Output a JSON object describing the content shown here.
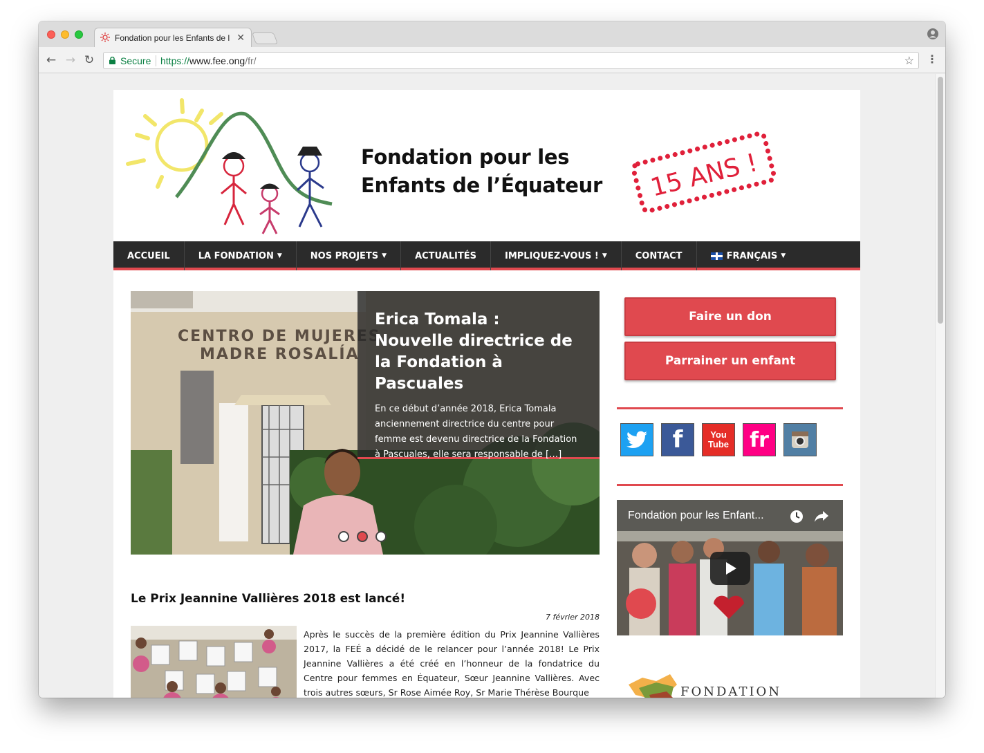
{
  "browser": {
    "tab_title": "Fondation pour les Enfants de l",
    "tab_close": "✕",
    "secure_label": "Secure",
    "url_scheme": "https://",
    "url_host": "www.fee.ong",
    "url_path": "/fr/"
  },
  "site": {
    "title_line1": "Fondation pour les",
    "title_line2": "Enfants de l’Équateur",
    "stamp": "15 ANS !"
  },
  "nav": {
    "items": [
      {
        "label": "ACCUEIL",
        "dropdown": false
      },
      {
        "label": "LA FONDATION",
        "dropdown": true
      },
      {
        "label": "NOS PROJETS",
        "dropdown": true
      },
      {
        "label": "ACTUALITÉS",
        "dropdown": false
      },
      {
        "label": "IMPLIQUEZ-VOUS !",
        "dropdown": true
      },
      {
        "label": "CONTACT",
        "dropdown": false
      },
      {
        "label": "FRANÇAIS",
        "dropdown": true,
        "flag": true
      }
    ]
  },
  "slider": {
    "sign_line1": "CENTRO DE MUJERES",
    "sign_line2": "MADRE ROSALÍA",
    "title": "Erica Tomala : Nouvelle directrice de la Fondation à Pascuales",
    "text": "En ce début d’année 2018, Erica Tomala anciennement directrice du centre pour femme est devenu directrice de la Fondation à Pascuales, elle sera responsable de […]",
    "slides_count": 3,
    "active_slide": 2
  },
  "article": {
    "title": "Le Prix Jeannine Vallières 2018 est lancé!",
    "date": "7 février 2018",
    "text": "Après le succès de la première édition du Prix Jeannine Vallières 2017, la FEÉ a décidé de le relancer pour l’année 2018! Le Prix Jeannine Vallières a été créé en l’honneur de la fondatrice du Centre pour femmes en Équateur, Sœur Jeannine Vallières. Avec trois autres sœurs, Sr Rose Aimée Roy, Sr Marie Thérèse Bourque"
  },
  "sidebar": {
    "donate_label": "Faire un don",
    "sponsor_label": "Parrainer un enfant",
    "socials": [
      {
        "name": "twitter-icon",
        "label": "",
        "color": "#1da1f2"
      },
      {
        "name": "facebook-icon",
        "label": "f",
        "color": "#3b5998"
      },
      {
        "name": "youtube-icon",
        "label": "You Tube",
        "color": "#e52d27"
      },
      {
        "name": "flickr-icon",
        "label": "fr",
        "color": "#ff0084"
      },
      {
        "name": "instagram-icon",
        "label": "",
        "color": "#517fa4"
      }
    ],
    "video_title": "Fondation pour les Enfant...",
    "partner_text": "FONDATION"
  },
  "colors": {
    "accent": "#e0494f",
    "nav_bg": "#2b2b2b"
  }
}
